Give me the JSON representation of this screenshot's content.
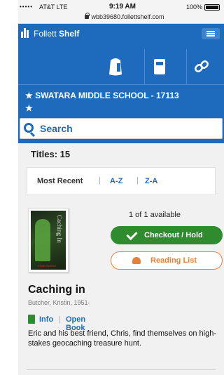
{
  "status_bar": {
    "signal": "•••••",
    "carrier": "AT&T  LTE",
    "time": "9:19 AM",
    "battery": "100%"
  },
  "url": "wbb39680.follettshelf.com",
  "brand": {
    "name_regular": "Follett",
    "name_bold": "Shelf"
  },
  "tools": [
    {
      "icon": "backpack-icon"
    },
    {
      "icon": "book-icon"
    },
    {
      "icon": "link-icon"
    }
  ],
  "school": {
    "name": "★ SWATARA MIDDLE SCHOOL - 17113",
    "star": "★"
  },
  "search": {
    "label": "Search"
  },
  "results": {
    "titles_label": "Titles: 15"
  },
  "sort": {
    "options": [
      "Most Recent",
      "A-Z",
      "Z-A"
    ],
    "separator": "|"
  },
  "book": {
    "cover_title": "Caching In",
    "cover_author": "Kristin Butcher",
    "availability": "1 of 1 available",
    "checkout_label": "Checkout / Hold",
    "reading_list_label": "Reading List",
    "title": "Caching in",
    "author": "Butcher, Kristin, 1951-",
    "info_label": "Info",
    "open_label": "Open Book",
    "link_separator": "|",
    "description": "Eric and his best friend, Chris, find themselves on high-stakes geocaching treasure hunt."
  },
  "colors": {
    "primary": "#1e6bbd",
    "checkout": "#2e8b2e",
    "reading_list": "#e8803a"
  }
}
